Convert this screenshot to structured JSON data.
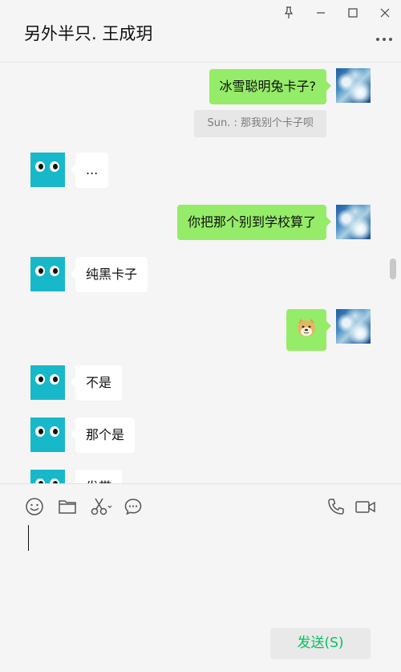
{
  "header": {
    "title": "另外半只. 王成玥"
  },
  "messages": [
    {
      "side": "out",
      "text": "冰雪聪明兔卡子?"
    },
    {
      "side": "quote",
      "text": "Sun. : 那我别个卡子呗"
    },
    {
      "side": "in",
      "text": "..."
    },
    {
      "side": "out",
      "text": "你把那个别到学校算了"
    },
    {
      "side": "in",
      "text": "纯黑卡子"
    },
    {
      "side": "out",
      "sticker": "doge-emoji"
    },
    {
      "side": "in",
      "text": "不是"
    },
    {
      "side": "in",
      "text": "那个是"
    },
    {
      "side": "in",
      "text": "发带"
    }
  ],
  "toolbar": {
    "icons": [
      "emoji-icon",
      "folder-icon",
      "scissors-icon",
      "chat-bubble-icon",
      "phone-icon",
      "video-call-icon"
    ]
  },
  "composer": {
    "send_label": "发送(S)"
  },
  "colors": {
    "outgoing_bubble": "#95ec69",
    "incoming_bubble": "#ffffff",
    "send_text": "#07c160",
    "avatar_bird": "#17b8c9"
  }
}
